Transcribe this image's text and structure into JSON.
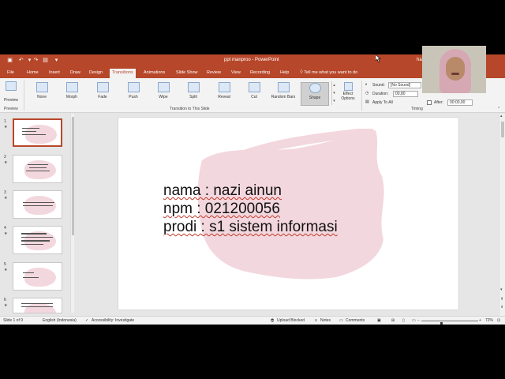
{
  "titlebar": {
    "title": "ppt manproo  -  PowerPoint",
    "user": "ha"
  },
  "tabs": [
    "File",
    "Home",
    "Insert",
    "Draw",
    "Design",
    "Transitions",
    "Animations",
    "Slide Show",
    "Review",
    "View",
    "Recording",
    "Help"
  ],
  "tell_me": "Tell me what you want to do",
  "ribbon": {
    "preview_label": "Preview",
    "preview_group": "Preview",
    "transitions": [
      "None",
      "Morph",
      "Fade",
      "Push",
      "Wipe",
      "Split",
      "Reveal",
      "Cut",
      "Random Bars",
      "Shape"
    ],
    "selected_transition": "Shape",
    "effect_options": "Effect",
    "effect_options_2": "Options",
    "group_label": "Transition to This Slide",
    "timing": {
      "sound_label": "Sound:",
      "sound_value": "[No Sound]",
      "duration_label": "Duration:",
      "duration_value": "00,80",
      "apply_all": "Apply To All",
      "after_label": "After:",
      "after_value": "00:00,00",
      "group_label": "Timing"
    }
  },
  "thumbnails": [
    {
      "num": "1",
      "star": "★"
    },
    {
      "num": "2",
      "star": "★"
    },
    {
      "num": "3",
      "star": "★"
    },
    {
      "num": "4",
      "star": "★"
    },
    {
      "num": "5",
      "star": "★"
    },
    {
      "num": "6",
      "star": "★"
    }
  ],
  "slide": {
    "lines": [
      "nama : nazi ainun",
      "npm : 021200056",
      "prodi : s1 sistem informasi"
    ],
    "brush_color": "#f3d7de"
  },
  "status": {
    "slide_of": "Slide 1 of 9",
    "language": "English (Indonesia)",
    "accessibility": "Accessibility: Investigate",
    "upload": "Upload Blocked",
    "notes": "Notes",
    "comments": "Comments",
    "zoom": "72%",
    "zoom_level_percent": 72
  },
  "colors": {
    "accent": "#b7472a",
    "ribbon_bg": "#f3f3f3"
  }
}
